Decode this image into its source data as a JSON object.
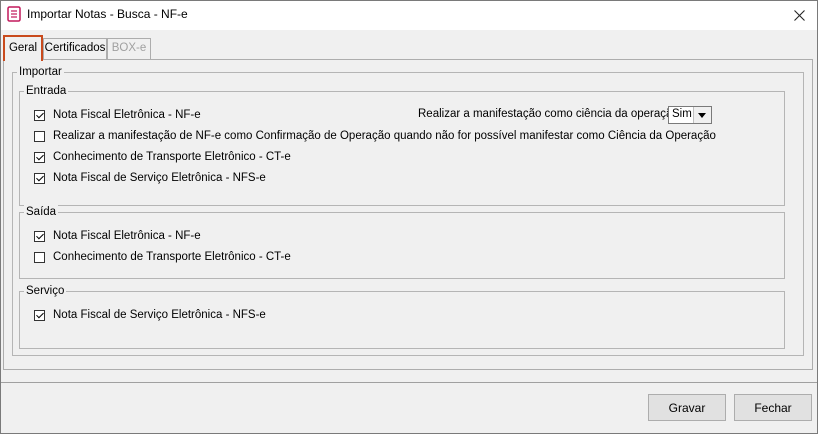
{
  "window": {
    "title": "Importar Notas - Busca - NF-e"
  },
  "tabs": [
    {
      "label": "Geral"
    },
    {
      "label": "Certificados"
    },
    {
      "label": "BOX-e"
    }
  ],
  "importar": {
    "label": "Importar",
    "entrada": {
      "label": "Entrada",
      "items": [
        {
          "label": "Nota Fiscal Eletrônica - NF-e",
          "checked": true
        },
        {
          "label": "Realizar a manifestação de NF-e como Confirmação de Operação quando não for possível manifestar como Ciência da Operação",
          "checked": false
        },
        {
          "label": "Conhecimento de Transporte Eletrônico - CT-e",
          "checked": true
        },
        {
          "label": "Nota Fiscal de Serviço Eletrônica - NFS-e",
          "checked": true
        }
      ],
      "manifest_label": "Realizar a manifestação como ciência da operação:",
      "manifest_value": "Sim"
    },
    "saida": {
      "label": "Saída",
      "items": [
        {
          "label": "Nota Fiscal Eletrônica - NF-e",
          "checked": true
        },
        {
          "label": "Conhecimento de Transporte Eletrônico - CT-e",
          "checked": false
        }
      ]
    },
    "servico": {
      "label": "Serviço",
      "items": [
        {
          "label": "Nota Fiscal de Serviço Eletrônica - NFS-e",
          "checked": true
        }
      ]
    }
  },
  "buttons": {
    "save": "Gravar",
    "close": "Fechar"
  },
  "icons": {
    "app": "document-icon",
    "close": "close-icon",
    "dropdown": "chevron-down-icon"
  }
}
